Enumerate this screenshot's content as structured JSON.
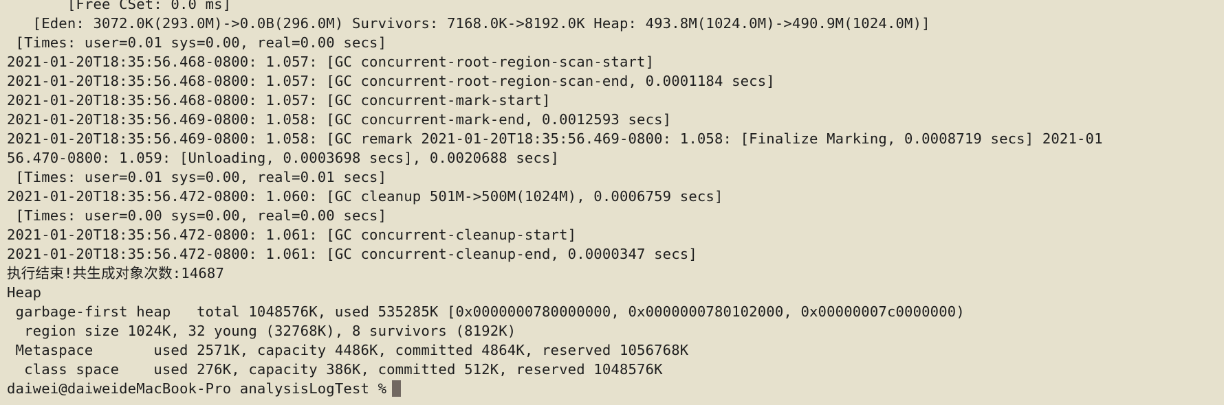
{
  "terminal": {
    "lines": [
      "       [Free CSet: 0.0 ms]",
      "   [Eden: 3072.0K(293.0M)->0.0B(296.0M) Survivors: 7168.0K->8192.0K Heap: 493.8M(1024.0M)->490.9M(1024.0M)]",
      " [Times: user=0.01 sys=0.00, real=0.00 secs]",
      "2021-01-20T18:35:56.468-0800: 1.057: [GC concurrent-root-region-scan-start]",
      "2021-01-20T18:35:56.468-0800: 1.057: [GC concurrent-root-region-scan-end, 0.0001184 secs]",
      "2021-01-20T18:35:56.468-0800: 1.057: [GC concurrent-mark-start]",
      "2021-01-20T18:35:56.469-0800: 1.058: [GC concurrent-mark-end, 0.0012593 secs]",
      "2021-01-20T18:35:56.469-0800: 1.058: [GC remark 2021-01-20T18:35:56.469-0800: 1.058: [Finalize Marking, 0.0008719 secs] 2021-01",
      "56.470-0800: 1.059: [Unloading, 0.0003698 secs], 0.0020688 secs]",
      " [Times: user=0.01 sys=0.00, real=0.01 secs]",
      "2021-01-20T18:35:56.472-0800: 1.060: [GC cleanup 501M->500M(1024M), 0.0006759 secs]",
      " [Times: user=0.00 sys=0.00, real=0.00 secs]",
      "2021-01-20T18:35:56.472-0800: 1.061: [GC concurrent-cleanup-start]",
      "2021-01-20T18:35:56.472-0800: 1.061: [GC concurrent-cleanup-end, 0.0000347 secs]",
      "执行结束!共生成对象次数:14687",
      "Heap",
      " garbage-first heap   total 1048576K, used 535285K [0x0000000780000000, 0x0000000780102000, 0x00000007c0000000)",
      "  region size 1024K, 32 young (32768K), 8 survivors (8192K)",
      " Metaspace       used 2571K, capacity 4486K, committed 4864K, reserved 1056768K",
      "  class space    used 276K, capacity 386K, committed 512K, reserved 1048576K"
    ],
    "prompt": "daiwei@daiweideMacBook-Pro analysisLogTest %"
  }
}
